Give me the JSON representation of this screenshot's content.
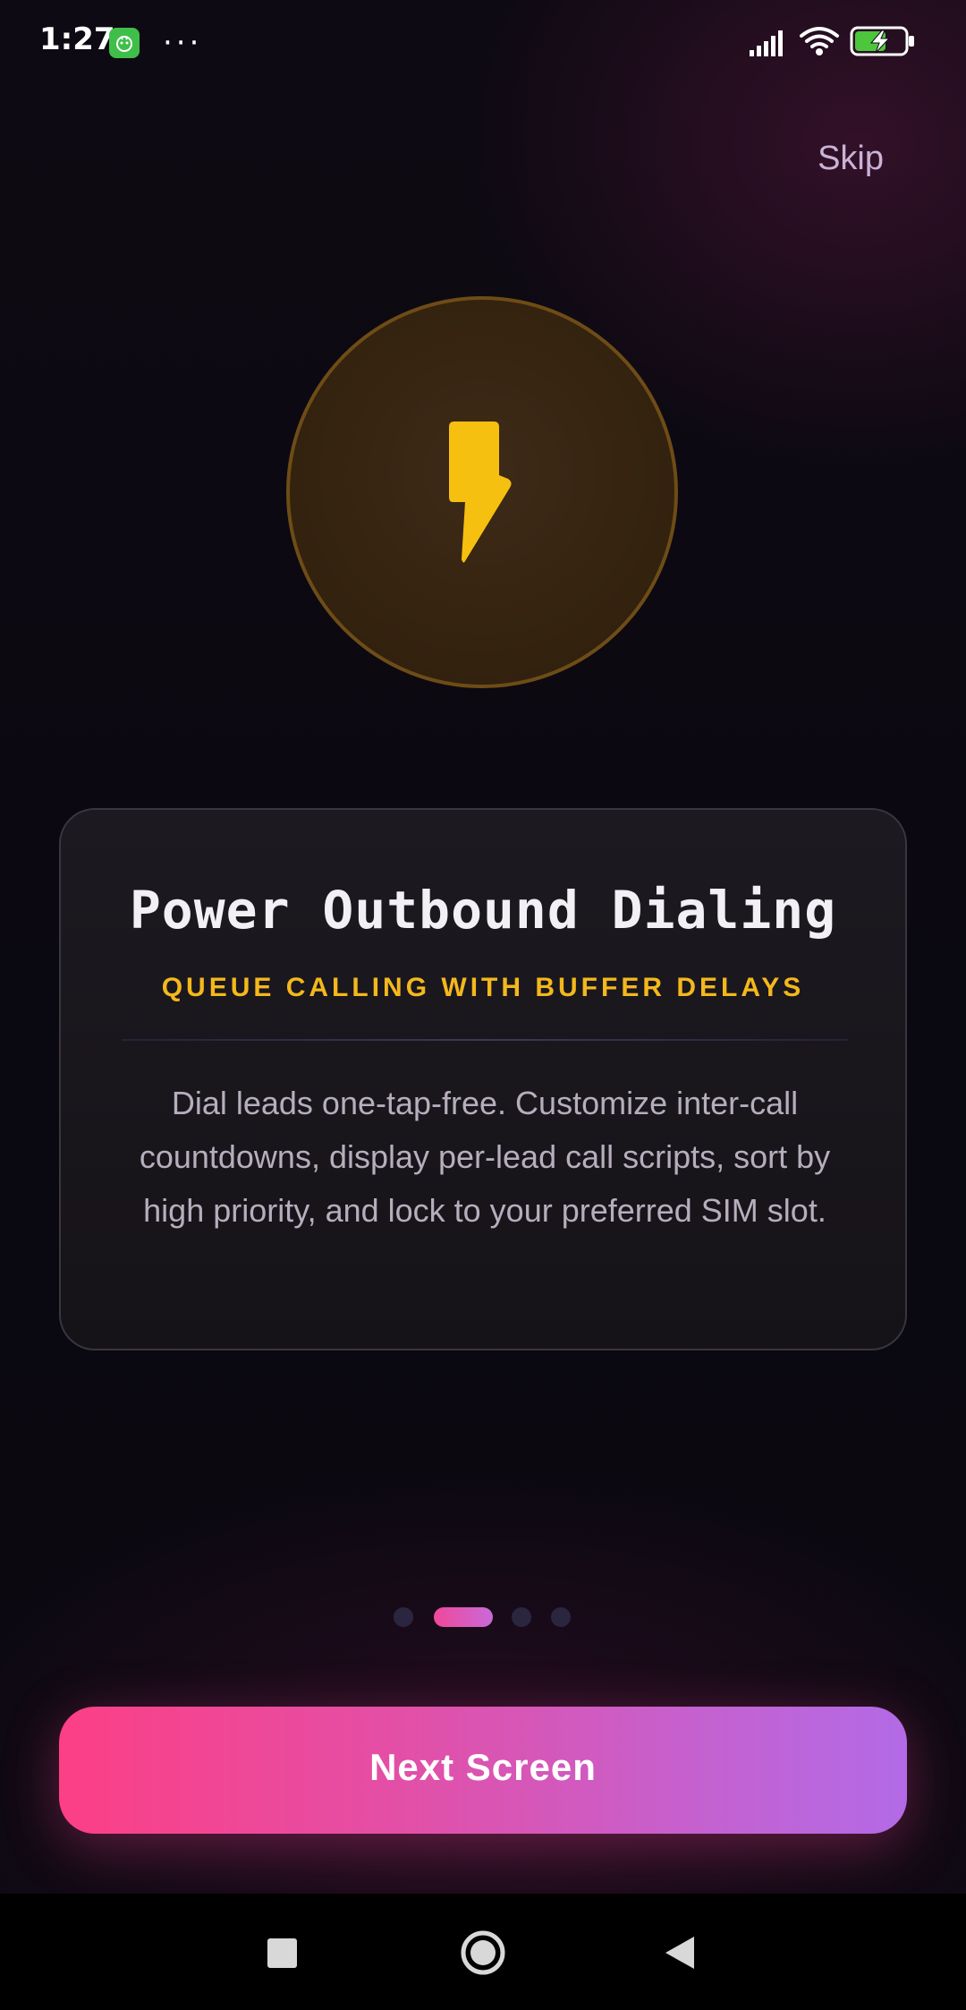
{
  "status_bar": {
    "time": "1:27",
    "app_icon": "notification-app-icon",
    "overflow": "···",
    "icons": [
      "signal-icon",
      "wifi-icon",
      "battery-charging-icon"
    ]
  },
  "skip_label": "Skip",
  "hero": {
    "icon": "lightning-bolt-icon",
    "color": "#f5c010"
  },
  "card": {
    "title": "Power Outbound Dialing",
    "subtitle": "QUEUE CALLING WITH BUFFER DELAYS",
    "body": "Dial leads one-tap-free. Customize inter-call countdowns, display per-lead call scripts, sort by high priority, and lock to your preferred SIM slot."
  },
  "pagination": {
    "total": 4,
    "active_index": 1
  },
  "next_button_label": "Next Screen",
  "colors": {
    "accent_start": "#fc3f86",
    "accent_end": "#b36ae6",
    "subtitle": "#f4b81c"
  },
  "nav_bar": {
    "icons": [
      "recents-square-icon",
      "home-circle-icon",
      "back-triangle-icon"
    ]
  }
}
